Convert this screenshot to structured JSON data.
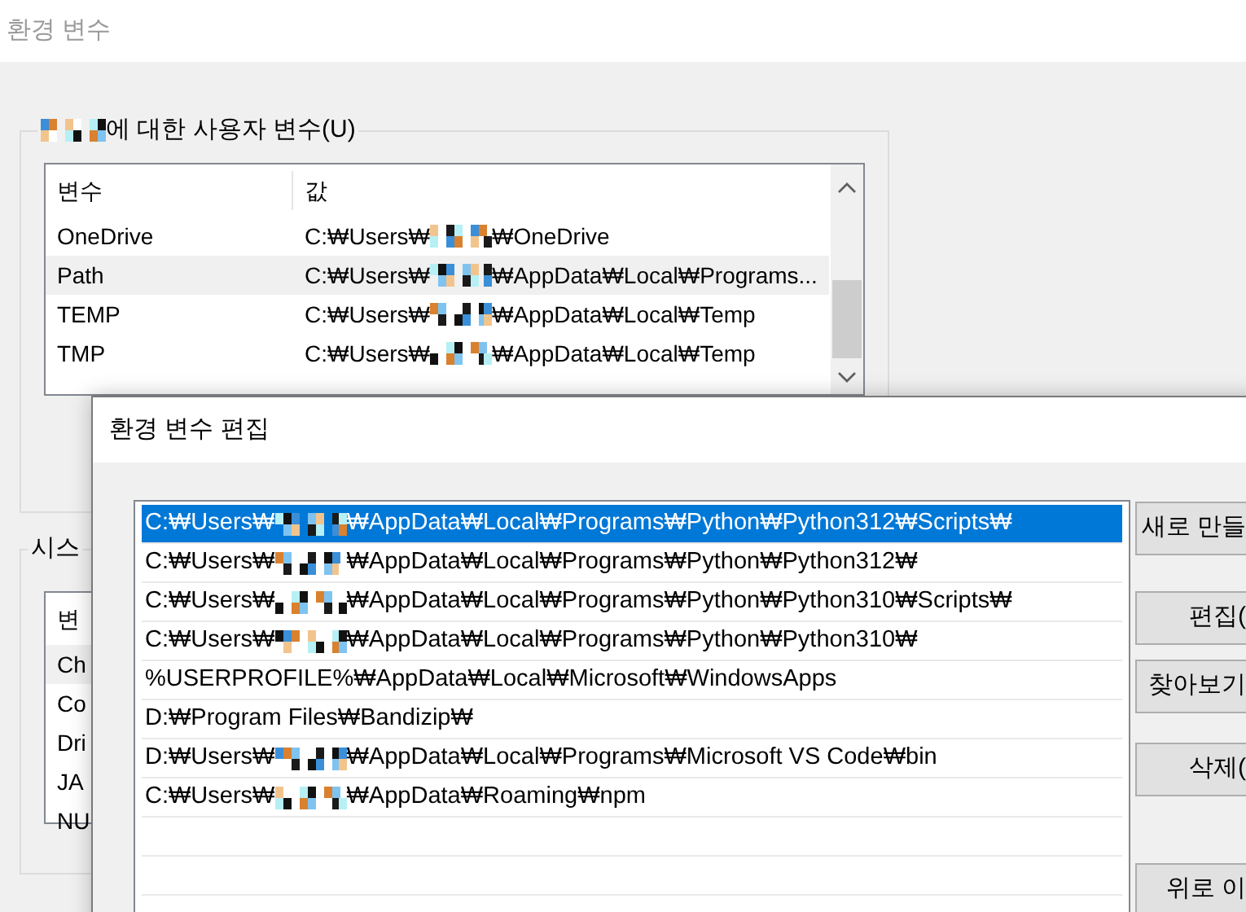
{
  "back_window": {
    "title": "환경 변수",
    "user_group": {
      "label": "에 대한 사용자 변수(U)",
      "columns": [
        "변수",
        "값"
      ],
      "rows": [
        {
          "name": "OneDrive",
          "value_before": "C:₩Users₩",
          "value_after": "₩OneDrive",
          "selected": false
        },
        {
          "name": "Path",
          "value_before": "C:₩Users₩",
          "value_after": "₩AppData₩Local₩Programs...",
          "selected": true
        },
        {
          "name": "TEMP",
          "value_before": "C:₩Users₩",
          "value_after": "₩AppData₩Local₩Temp",
          "selected": false
        },
        {
          "name": "TMP",
          "value_before": "C:₩Users₩",
          "value_after": "₩AppData₩Local₩Temp",
          "selected": false
        }
      ]
    },
    "system_group": {
      "label": "시스",
      "columns": [
        "변"
      ],
      "rows": [
        {
          "name": "Ch",
          "selected": true
        },
        {
          "name": "Co",
          "selected": false
        },
        {
          "name": "Dri",
          "selected": false
        },
        {
          "name": "JA",
          "selected": false
        },
        {
          "name": "NU",
          "selected": false
        }
      ]
    }
  },
  "edit_dialog": {
    "title": "환경 변수 편집",
    "entries": [
      {
        "kind": "redacted",
        "text_before": "C:₩Users₩",
        "text_after": "₩AppData₩Local₩Programs₩Python₩Python312₩Scripts₩",
        "selected": true
      },
      {
        "kind": "redacted",
        "text_before": "C:₩Users₩",
        "text_after": "₩AppData₩Local₩Programs₩Python₩Python312₩",
        "selected": false
      },
      {
        "kind": "redacted",
        "text_before": "C:₩Users₩",
        "text_after": "₩AppData₩Local₩Programs₩Python₩Python310₩Scripts₩",
        "selected": false
      },
      {
        "kind": "redacted",
        "text_before": "C:₩Users₩",
        "text_after": "₩AppData₩Local₩Programs₩Python₩Python310₩",
        "selected": false
      },
      {
        "kind": "plain",
        "text": "%USERPROFILE%₩AppData₩Local₩Microsoft₩WindowsApps",
        "selected": false
      },
      {
        "kind": "plain",
        "text": "D:₩Program Files₩Bandizip₩",
        "selected": false
      },
      {
        "kind": "redacted",
        "text_before": "D:₩Users₩",
        "text_after": "₩AppData₩Local₩Programs₩Microsoft VS Code₩bin",
        "selected": false
      },
      {
        "kind": "redacted",
        "text_before": "C:₩Users₩",
        "text_after": "₩AppData₩Roaming₩npm",
        "selected": false
      }
    ],
    "buttons": [
      {
        "label": "새로 만들"
      },
      {
        "label": "편집("
      },
      {
        "label": "찾아보기"
      },
      {
        "label": "삭제("
      },
      {
        "label": "위로 이"
      }
    ]
  }
}
